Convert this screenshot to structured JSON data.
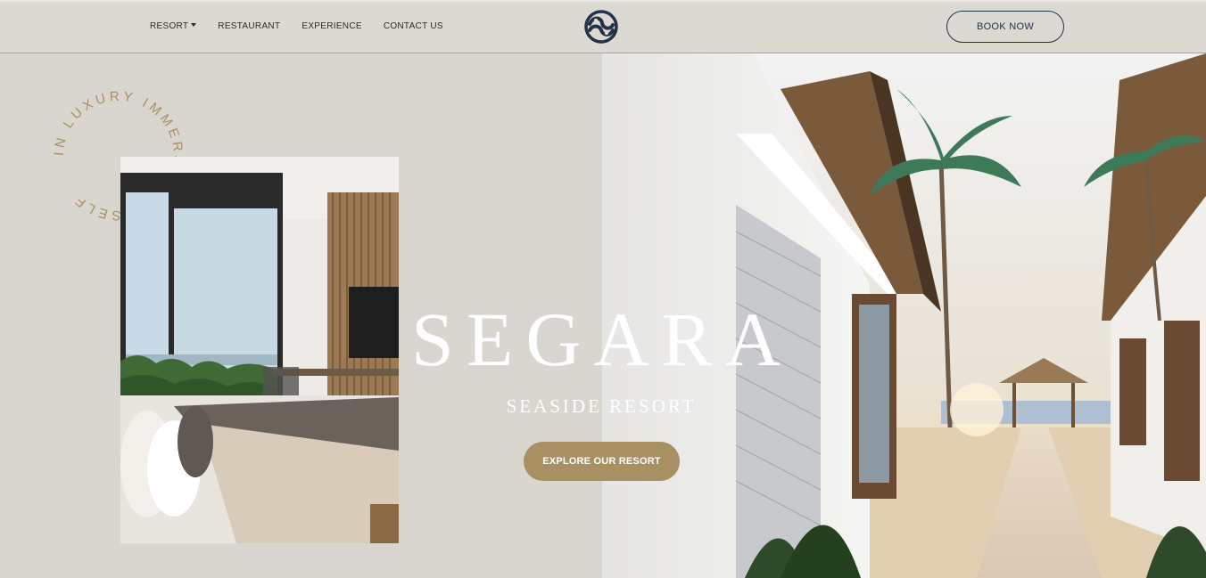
{
  "nav": {
    "items": [
      {
        "label": "RESORT",
        "has_dropdown": true
      },
      {
        "label": "RESTAURANT"
      },
      {
        "label": "EXPERIENCE"
      },
      {
        "label": "CONTACT US"
      }
    ]
  },
  "header": {
    "logo_icon": "segara-wave-logo-icon",
    "book_label": "BOOK NOW"
  },
  "decor": {
    "circle_text": "IN LUXURY IMMERSE YOURSELF "
  },
  "hero": {
    "title": "SEGARA",
    "subtitle": "SEASIDE RESORT",
    "cta_label": "EXPLORE OUR RESORT"
  },
  "colors": {
    "background": "#d9d6d0",
    "accent_gold": "#a89063",
    "navy": "#223247",
    "header_line": "#b9a173"
  }
}
